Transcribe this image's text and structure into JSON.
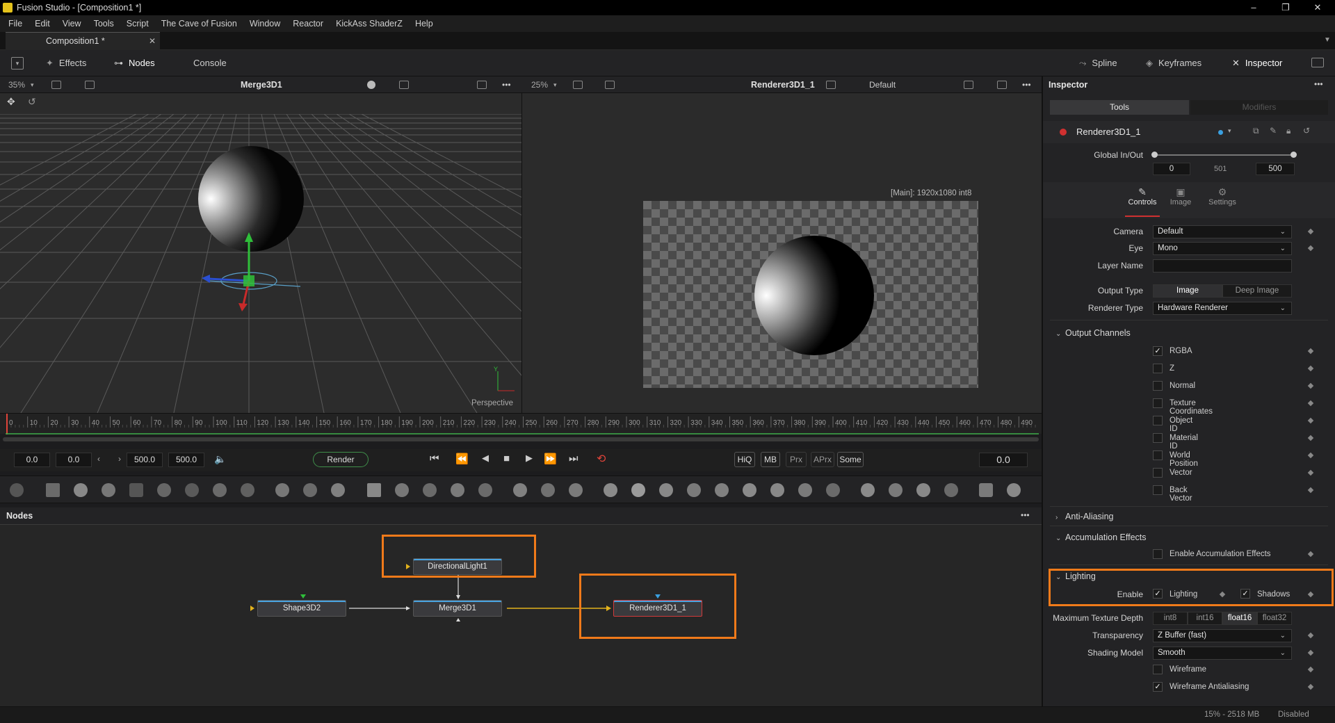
{
  "app": {
    "title": "Fusion Studio - [Composition1 *]",
    "window_controls": [
      "–",
      "❐",
      "✕"
    ]
  },
  "menu": [
    "File",
    "Edit",
    "View",
    "Tools",
    "Script",
    "The Cave of Fusion",
    "Window",
    "Reactor",
    "KickAss ShaderZ",
    "Help"
  ],
  "comp_tab": {
    "label": "Composition1 *",
    "close": "✕"
  },
  "toolbar": {
    "effects": "Effects",
    "nodes": "Nodes",
    "console": "Console",
    "spline": "Spline",
    "keyframes": "Keyframes",
    "inspector": "Inspector"
  },
  "viewer1": {
    "zoom": "35%",
    "title": "Merge3D1",
    "overlay": "Perspective"
  },
  "viewer2": {
    "zoom": "25%",
    "title": "Renderer3D1_1",
    "lut": "Default",
    "info": "[Main]: 1920x1080 int8"
  },
  "ruler": {
    "ticks": [
      "0",
      "10",
      "20",
      "30",
      "40",
      "50",
      "60",
      "70",
      "80",
      "90",
      "100",
      "110",
      "120",
      "130",
      "140",
      "150",
      "160",
      "170",
      "180",
      "190",
      "200",
      "210",
      "220",
      "230",
      "240",
      "250",
      "260",
      "270",
      "280",
      "290",
      "300",
      "310",
      "320",
      "330",
      "340",
      "350",
      "360",
      "370",
      "380",
      "390",
      "400",
      "410",
      "420",
      "430",
      "440",
      "450",
      "460",
      "470",
      "480",
      "490"
    ]
  },
  "transport": {
    "start": "0.0",
    "render_start": "0.0",
    "render_end": "500.0",
    "end": "500.0",
    "render_label": "Render",
    "hiq": "HiQ",
    "mb": "MB",
    "prx": "Prx",
    "aprx": "APrx",
    "some": "Some",
    "current": "0.0"
  },
  "nodes_panel": {
    "title": "Nodes",
    "nodes": [
      "DirectionalLight1",
      "Shape3D2",
      "Merge3D1",
      "Renderer3D1_1"
    ]
  },
  "status": {
    "memory": "15% - 2518 MB",
    "state": "Disabled"
  },
  "inspector": {
    "title": "Inspector",
    "tabs": [
      "Tools",
      "Modifiers"
    ],
    "tool_name": "Renderer3D1_1",
    "global_label": "Global In/Out",
    "global_in": "0",
    "global_mid": "501",
    "global_out": "500",
    "subtabs": [
      "Controls",
      "Image",
      "Settings"
    ],
    "camera_label": "Camera",
    "camera_value": "Default",
    "eye_label": "Eye",
    "eye_value": "Mono",
    "layer_label": "Layer Name",
    "layer_value": "",
    "output_type_label": "Output Type",
    "output_type_options": [
      "Image",
      "Deep Image"
    ],
    "renderer_type_label": "Renderer Type",
    "renderer_type_value": "Hardware Renderer",
    "output_channels_label": "Output Channels",
    "channels": [
      {
        "label": "RGBA",
        "checked": true
      },
      {
        "label": "Z",
        "checked": false
      },
      {
        "label": "Normal",
        "checked": false
      },
      {
        "label": "Texture Coordinates",
        "checked": false
      },
      {
        "label": "Object ID",
        "checked": false
      },
      {
        "label": "Material ID",
        "checked": false
      },
      {
        "label": "World Position",
        "checked": false
      },
      {
        "label": "Vector",
        "checked": false
      },
      {
        "label": "Back Vector",
        "checked": false
      }
    ],
    "anti_aliasing_label": "Anti-Aliasing",
    "accum_label": "Accumulation Effects",
    "enable_accum_label": "Enable Accumulation Effects",
    "lighting_label": "Lighting",
    "enable_label": "Enable",
    "lighting_chk": "Lighting",
    "shadows_chk": "Shadows",
    "max_tex_label": "Maximum Texture Depth",
    "tex_options": [
      "int8",
      "int16",
      "float16",
      "float32"
    ],
    "transparency_label": "Transparency",
    "transparency_value": "Z Buffer (fast)",
    "shading_label": "Shading Model",
    "shading_value": "Smooth",
    "wireframe_label": "Wireframe",
    "wireframe_aa_label": "Wireframe Antialiasing"
  }
}
